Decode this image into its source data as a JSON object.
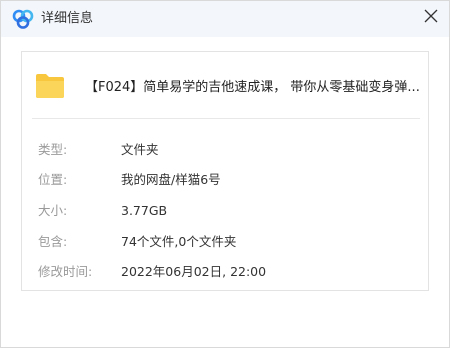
{
  "window": {
    "title": "详细信息",
    "app_icon": "baidu-netdisk-icon",
    "close_icon": "close-icon"
  },
  "file": {
    "icon": "folder-icon",
    "name": "【F024】简单易学的吉他速成课， 带你从零基础变身弹..."
  },
  "details": [
    {
      "label": "类型:",
      "value": "文件夹"
    },
    {
      "label": "位置:",
      "value": "我的网盘/样猫6号"
    },
    {
      "label": "大小:",
      "value": "3.77GB"
    },
    {
      "label": "包含:",
      "value": "74个文件,0个文件夹"
    },
    {
      "label": "修改时间:",
      "value": "2022年06月02日, 22:00"
    }
  ],
  "colors": {
    "titlebar_bg": "#f3f6fb",
    "folder_yellow": "#f8c73e",
    "icon_blue": "#2f8df5"
  }
}
